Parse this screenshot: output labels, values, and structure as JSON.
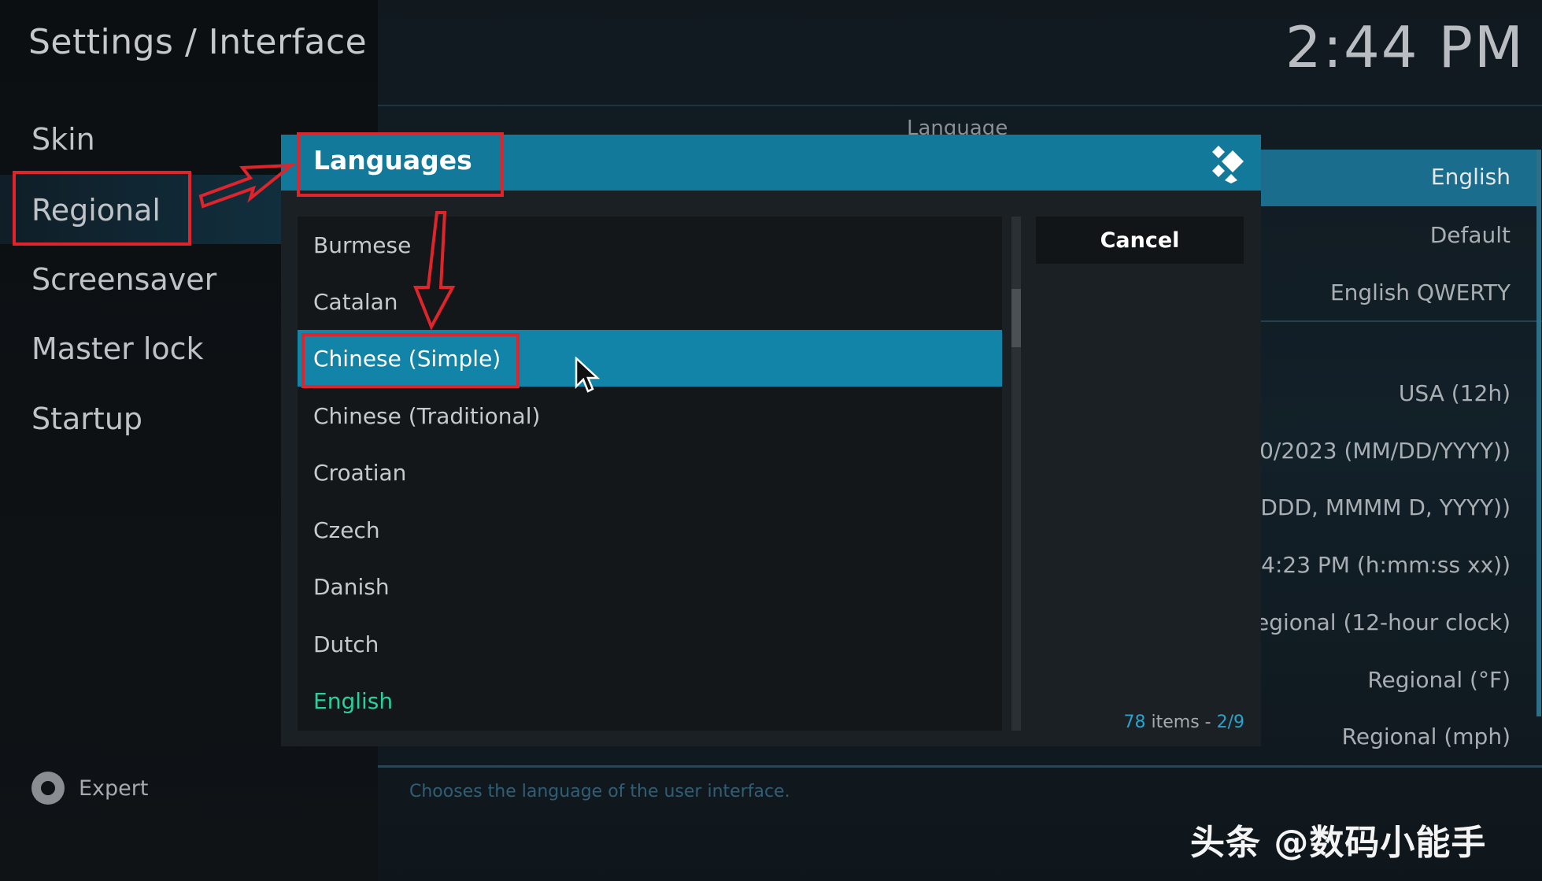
{
  "header": {
    "title": "Settings / Interface",
    "clock": "2:44 PM"
  },
  "sidebar": {
    "items": [
      {
        "label": "Skin"
      },
      {
        "label": "Regional"
      },
      {
        "label": "Screensaver"
      },
      {
        "label": "Master lock"
      },
      {
        "label": "Startup"
      }
    ],
    "selected": "Regional",
    "expert_label": "Expert"
  },
  "settings": {
    "section_header": "Language",
    "values": [
      "English",
      "Default",
      "English QWERTY",
      "USA (12h)",
      "0/2023 (MM/DD/YYYY))",
      "DDD, MMMM D, YYYY))",
      "4:23 PM (h:mm:ss xx))",
      "egional (12-hour clock)",
      "Regional (°F)",
      "Regional (mph)"
    ],
    "description": "Chooses the language of the user interface."
  },
  "dialog": {
    "title": "Languages",
    "items": [
      "Burmese",
      "Catalan",
      "Chinese (Simple)",
      "Chinese (Traditional)",
      "Croatian",
      "Czech",
      "Danish",
      "Dutch",
      "English"
    ],
    "selected_item": "Chinese (Simple)",
    "current_item": "English",
    "cancel_label": "Cancel",
    "count": {
      "items": "78",
      "items_label": "items -",
      "page": "2/9"
    }
  },
  "watermark": "头条 @数码小能手",
  "colors": {
    "accent": "#12799b",
    "selection": "#1184a7",
    "current_language": "#27d29a",
    "annotation": "#e0242b"
  }
}
